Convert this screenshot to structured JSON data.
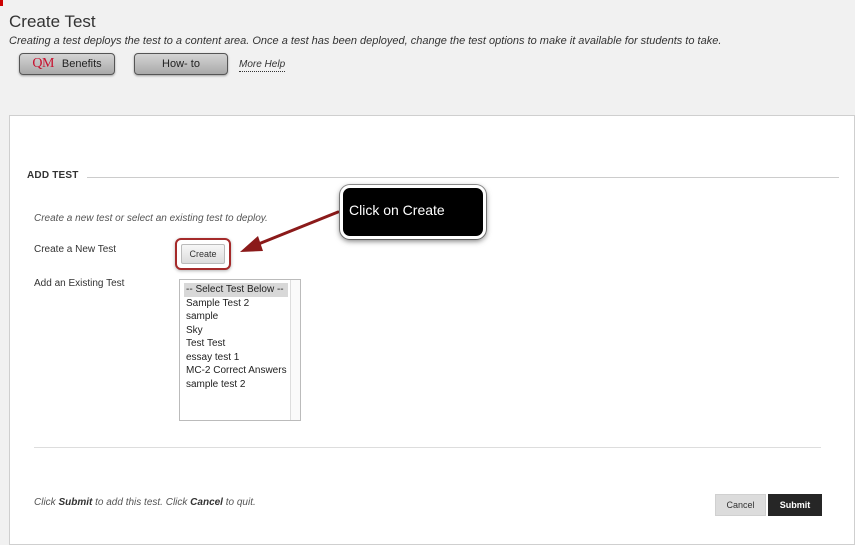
{
  "header": {
    "title": "Create Test",
    "description": "Creating a test deploys the test to a content area. Once a test has been deployed, change the test options to make it available for students to take.",
    "qm_logo_text": "QM",
    "benefits_label": "Benefits",
    "howto_label": "How- to",
    "more_help_label": "More Help"
  },
  "section": {
    "title": "ADD TEST",
    "instructions": "Create a new test or select an existing test to deploy.",
    "create_new_label": "Create a New Test",
    "create_button_label": "Create",
    "add_existing_label": "Add an Existing Test",
    "tests": [
      "-- Select Test Below --",
      "Sample Test 2",
      "sample",
      "Sky",
      "Test Test",
      "essay test 1",
      "MC-2 Correct Answers",
      "sample test 2"
    ],
    "selected_test": "-- Select Test Below --"
  },
  "footer": {
    "text_prefix": "Click ",
    "submit_word": "Submit",
    "text_middle": " to add this test. Click ",
    "cancel_word": "Cancel",
    "text_suffix": " to quit.",
    "cancel_label": "Cancel",
    "submit_label": "Submit"
  },
  "annotation": {
    "callout_text": "Click on Create",
    "arrow_color": "#8b1a1a"
  }
}
